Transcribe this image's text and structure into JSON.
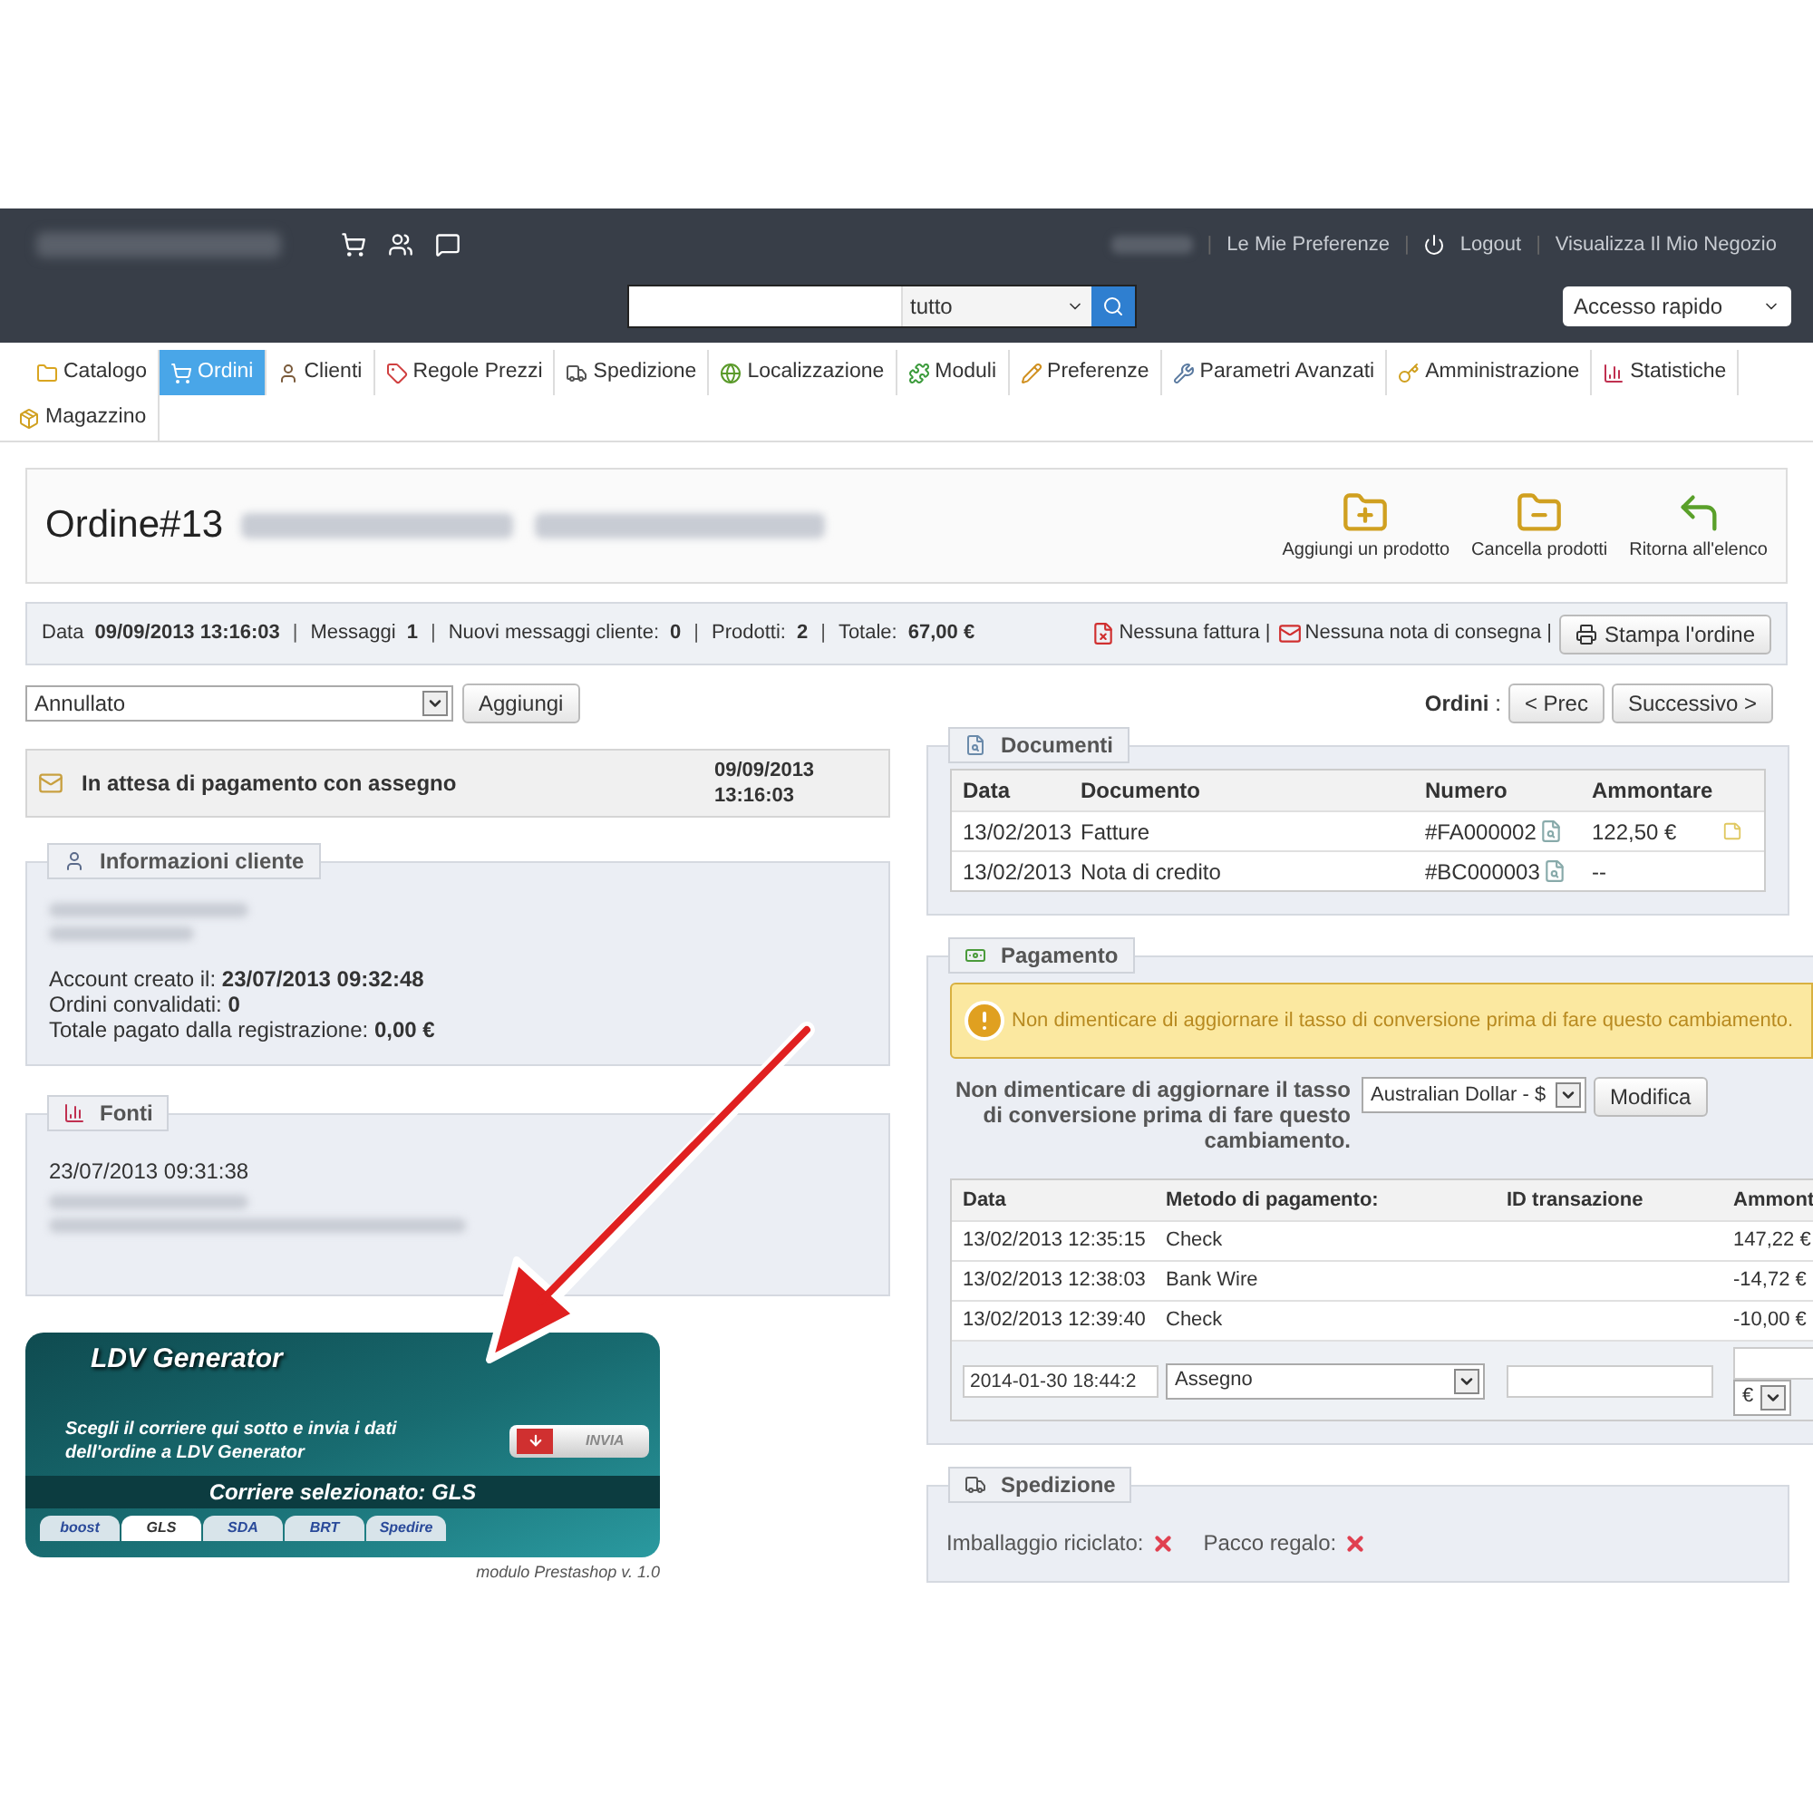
{
  "header": {
    "links": [
      "Le Mie Preferenze",
      "Logout",
      "Visualizza Il Mio Negozio"
    ],
    "separator": "|",
    "search": {
      "scope": "tutto"
    },
    "quick_access": "Accesso rapido"
  },
  "nav": [
    {
      "label": "Catalogo",
      "kind": "folder",
      "selected": false
    },
    {
      "label": "Ordini",
      "kind": "cart",
      "selected": true
    },
    {
      "label": "Clienti",
      "kind": "user",
      "selected": false
    },
    {
      "label": "Regole Prezzi",
      "kind": "tag",
      "selected": false
    },
    {
      "label": "Spedizione",
      "kind": "truck",
      "selected": false
    },
    {
      "label": "Localizzazione",
      "kind": "globe",
      "selected": false
    },
    {
      "label": "Moduli",
      "kind": "puzzle",
      "selected": false
    },
    {
      "label": "Preferenze",
      "kind": "pencil",
      "selected": false
    },
    {
      "label": "Parametri Avanzati",
      "kind": "wrench",
      "selected": false
    },
    {
      "label": "Amministrazione",
      "kind": "key",
      "selected": false
    },
    {
      "label": "Statistiche",
      "kind": "chart",
      "selected": false
    },
    {
      "label": "Magazzino",
      "kind": "box",
      "selected": false
    }
  ],
  "order": {
    "title": "Ordine#13",
    "actions": [
      {
        "label": "Aggiungi un prodotto",
        "kind": "add"
      },
      {
        "label": "Cancella prodotti",
        "kind": "remove"
      },
      {
        "label": "Ritorna all'elenco",
        "kind": "back"
      }
    ]
  },
  "summary": {
    "separator": "|",
    "items": [
      {
        "label": "Data",
        "value": "09/09/2013 13:16:03"
      },
      {
        "label": "Messaggi",
        "value": "1"
      },
      {
        "label": "Nuovi messaggi cliente:",
        "value": "0"
      },
      {
        "label": "Prodotti:",
        "value": "2"
      },
      {
        "label": "Totale:",
        "value": "67,00 €"
      }
    ],
    "invoice": "Nessuna fattura |",
    "delivery": "Nessuna nota di consegna |",
    "print": "Stampa l'ordine"
  },
  "status_select": {
    "value": "Annullato",
    "button": "Aggiungi"
  },
  "order_nav": {
    "label": "Ordini",
    "separator": ":",
    "prev": "< Prec",
    "next": "Successivo >"
  },
  "history": {
    "status": "In attesa di pagamento con assegno",
    "date": "09/09/2013",
    "time": "13:16:03"
  },
  "customer": {
    "title": "Informazioni cliente",
    "lines": [
      {
        "label": "Account creato il:",
        "value": "23/07/2013 09:32:48"
      },
      {
        "label": "Ordini convalidati:",
        "value": "0"
      },
      {
        "label": "Totale pagato dalla registrazione:",
        "value": "0,00 €"
      }
    ]
  },
  "sources": {
    "title": "Fonti",
    "date": "23/07/2013 09:31:38"
  },
  "ldv": {
    "title": "LDV Generator",
    "text": "Scegli il corriere qui sotto e invia i dati dell'ordine a LDV Generator",
    "button": "INVIA",
    "selected_carrier": "Corriere selezionato: GLS",
    "carriers": [
      {
        "label": "boost",
        "selected": false
      },
      {
        "label": "GLS",
        "selected": true
      },
      {
        "label": "SDA",
        "selected": false
      },
      {
        "label": "BRT",
        "selected": false
      },
      {
        "label": "Spedire",
        "selected": false
      }
    ],
    "footer": "modulo Prestashop v. 1.0"
  },
  "documents": {
    "title": "Documenti",
    "columns": [
      "Data",
      "Documento",
      "Numero",
      "Ammontare"
    ],
    "rows": [
      {
        "date": "13/02/2013",
        "document": "Fatture",
        "number": "#FA000002",
        "amount": "122,50 €",
        "note": true
      },
      {
        "date": "13/02/2013",
        "document": "Nota di credito",
        "number": "#BC000003",
        "amount": "--",
        "note": false
      }
    ]
  },
  "payment": {
    "title": "Pagamento",
    "warning": "Non dimenticare di aggiornare il tasso di conversione prima di fare questo cambiamento.",
    "currency_label": "Non dimenticare di aggiornare il tasso di conversione prima di fare questo cambiamento.",
    "currency": "Australian Dollar - $",
    "change_button": "Modifica",
    "columns": [
      "Data",
      "Metodo di pagamento:",
      "ID transazione",
      "Ammont"
    ],
    "rows": [
      {
        "date": "13/02/2013 12:35:15",
        "method": "Check",
        "amount": "147,22 €"
      },
      {
        "date": "13/02/2013 12:38:03",
        "method": "Bank Wire",
        "amount": "-14,72 €"
      },
      {
        "date": "13/02/2013 12:39:40",
        "method": "Check",
        "amount": "-10,00 €"
      }
    ],
    "new_row": {
      "date": "2014-01-30 18:44:2",
      "method": "Assegno",
      "currency": "€"
    }
  },
  "shipping": {
    "title": "Spedizione",
    "items": [
      {
        "label": "Imballaggio riciclato:",
        "on": false
      },
      {
        "label": "Pacco regalo:",
        "on": false
      }
    ]
  }
}
